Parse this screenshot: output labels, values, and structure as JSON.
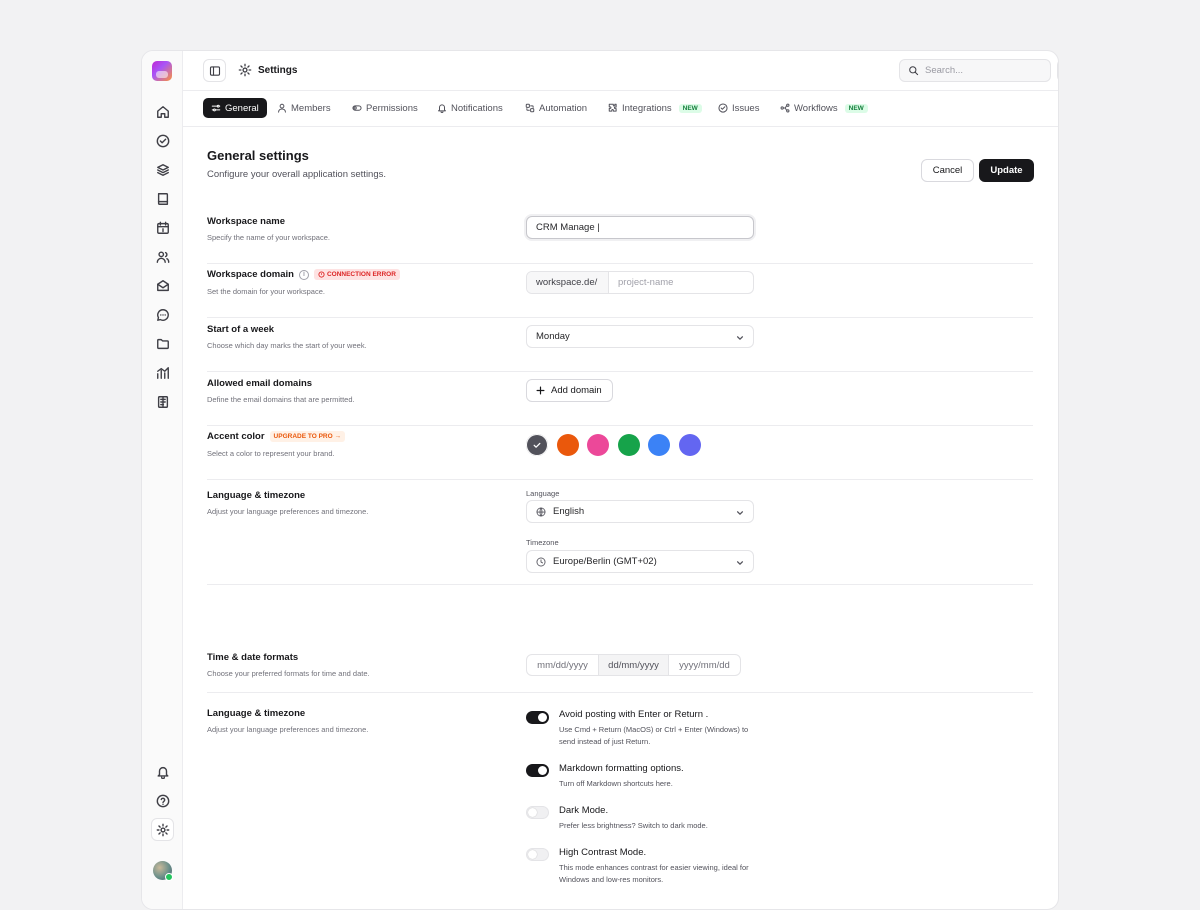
{
  "topbar": {
    "title": "Settings",
    "search_placeholder": "Search..."
  },
  "tabs": [
    {
      "label": "General",
      "icon": "sliders-icon",
      "active": true
    },
    {
      "label": "Members",
      "icon": "user-icon"
    },
    {
      "label": "Permissions",
      "icon": "toggle-icon"
    },
    {
      "label": "Notifications",
      "icon": "bell-icon"
    },
    {
      "label": "Automation",
      "icon": "automation-icon"
    },
    {
      "label": "Integrations",
      "icon": "puzzle-icon",
      "badge": "NEW"
    },
    {
      "label": "Issues",
      "icon": "check-circle-icon"
    },
    {
      "label": "Workflows",
      "icon": "workflow-icon",
      "badge": "NEW"
    }
  ],
  "header": {
    "title": "General settings",
    "subtitle": "Configure your overall application settings.",
    "cancel_label": "Cancel",
    "update_label": "Update"
  },
  "workspace_name": {
    "label": "Workspace name",
    "desc": "Specify the name of your workspace.",
    "value": "CRM Manage |"
  },
  "workspace_domain": {
    "label": "Workspace domain",
    "badge": "CONNECTION ERROR",
    "desc": "Set the domain for your workspace.",
    "prefix": "workspace.de/",
    "placeholder": "project-name"
  },
  "week_start": {
    "label": "Start of a week",
    "desc": "Choose which day marks the start of your week.",
    "value": "Monday"
  },
  "email_domains": {
    "label": "Allowed email domains",
    "desc": "Define the email domains that are permitted.",
    "button": "Add domain"
  },
  "accent": {
    "label": "Accent color",
    "badge": "UPGRADE TO PRO →",
    "desc": "Select a color to represent your brand.",
    "colors": [
      "#52525b",
      "#ea580c",
      "#ec4899",
      "#16a34a",
      "#3b82f6",
      "#6366f1"
    ],
    "selected": 0
  },
  "language_tz": {
    "label": "Language & timezone",
    "desc": "Adjust your language preferences and timezone.",
    "language_label": "Language",
    "language_value": "English",
    "timezone_label": "Timezone",
    "timezone_value": "Europe/Berlin (GMT+02)"
  },
  "formats": {
    "label": "Time & date formats",
    "desc": "Choose your preferred formats for time and date.",
    "options": [
      "mm/dd/yyyy",
      "dd/mm/yyyy",
      "yyyy/mm/dd"
    ],
    "selected": 1
  },
  "prefs": {
    "label": "Language & timezone",
    "desc": "Adjust your language preferences and timezone.",
    "toggles": [
      {
        "title": "Avoid posting with Enter or Return .",
        "desc": "Use Cmd + Return (MacOS) or Ctrl + Enter (Windows) to send instead of just Return.",
        "on": true
      },
      {
        "title": "Markdown formatting options.",
        "desc": "Turn off Markdown shortcuts here.",
        "on": true
      },
      {
        "title": "Dark Mode.",
        "desc": "Prefer less brightness? Switch to dark mode.",
        "on": false
      },
      {
        "title": "High Contrast Mode.",
        "desc": "This mode enhances contrast for easier viewing, ideal for Windows and low-res monitors.",
        "on": false
      }
    ]
  }
}
